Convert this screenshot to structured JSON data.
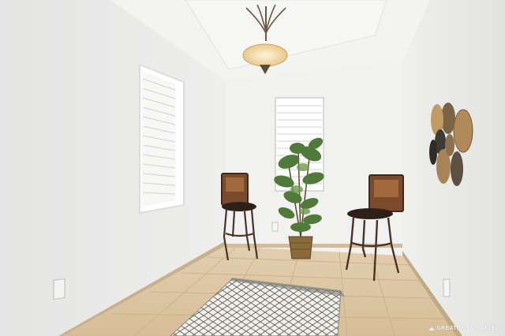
{
  "scene": {
    "description_free": true,
    "colors": {
      "wall_left": "#ececeb",
      "wall_back": "#f1f1f0",
      "wall_right": "#e7e7e6",
      "ceiling": "#f2f2f1",
      "floor_tile": "#dcc6a4",
      "baseboard": "#c9b08c",
      "chair_wood": "#8a5a3a",
      "chair_seat": "#3b2a20",
      "plant_green": "#4f7a3a",
      "basket": "#8a6a3a"
    }
  },
  "watermark": {
    "text": "GREATER MLS",
    "sub": "ALLEN"
  }
}
